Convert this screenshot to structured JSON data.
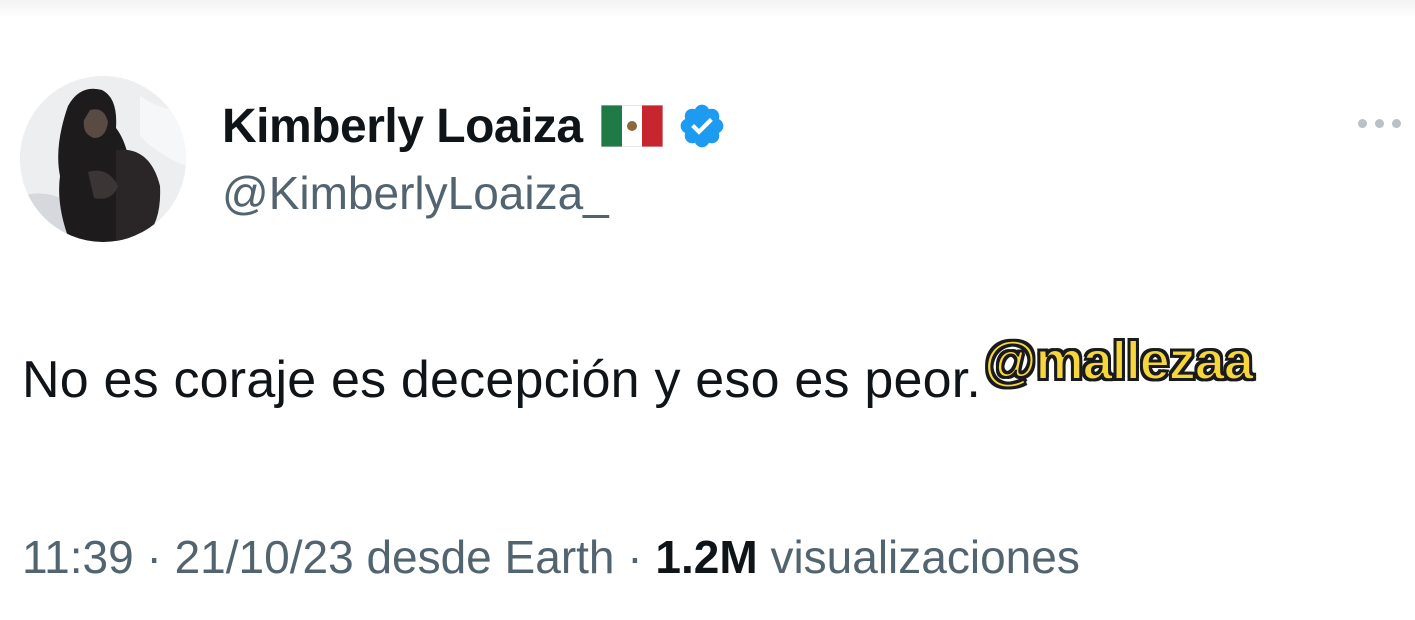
{
  "tweet": {
    "author": {
      "display_name": "Kimberly Loaiza",
      "flag_icon": "mexico-flag-icon",
      "verified_icon": "verified-badge-icon",
      "verified_color": "#1d9bf0",
      "handle": "@KimberlyLoaiza_"
    },
    "text": "No es coraje es decepción y eso es peor.",
    "meta": {
      "time": "11:39",
      "separator": "·",
      "date": "21/10/23",
      "source": "desde Earth",
      "views_count": "1.2M",
      "views_label": "visualizaciones"
    },
    "more_icon": "more-options-icon"
  },
  "overlay": {
    "watermark": "@mallezaa",
    "watermark_color": "#f5d63d"
  }
}
